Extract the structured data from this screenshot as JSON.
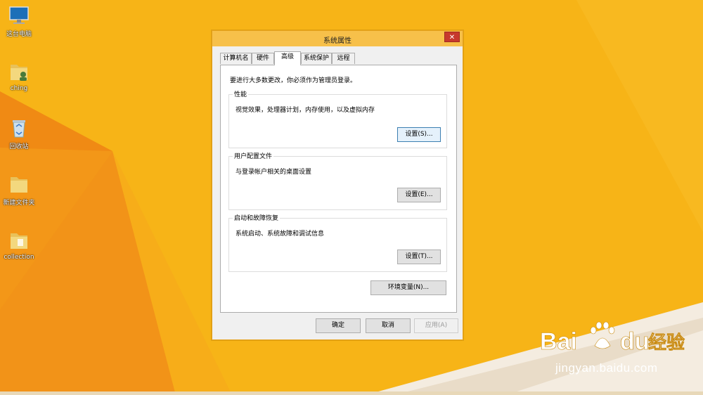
{
  "desktop": {
    "icons": [
      {
        "label": "这台电脑",
        "icon": "this-pc-icon"
      },
      {
        "label": "ching",
        "icon": "user-folder-icon"
      },
      {
        "label": "回收站",
        "icon": "recycle-bin-icon"
      },
      {
        "label": "新建文件夹",
        "icon": "folder-icon"
      },
      {
        "label": "collection",
        "icon": "folder-icon"
      }
    ]
  },
  "dialog": {
    "title": "系统属性",
    "close_symbol": "✕",
    "tabs": [
      {
        "label": "计算机名"
      },
      {
        "label": "硬件"
      },
      {
        "label": "高级"
      },
      {
        "label": "系统保护"
      },
      {
        "label": "远程"
      }
    ],
    "active_tab": "高级",
    "notice": "要进行大多数更改，你必须作为管理员登录。",
    "groups": {
      "performance": {
        "legend": "性能",
        "description": "视觉效果，处理器计划，内存使用，以及虚拟内存",
        "button": "设置(S)..."
      },
      "user_profiles": {
        "legend": "用户配置文件",
        "description": "与登录帐户相关的桌面设置",
        "button": "设置(E)..."
      },
      "startup_recovery": {
        "legend": "启动和故障恢复",
        "description": "系统启动、系统故障和调试信息",
        "button": "设置(T)..."
      }
    },
    "env_button": "环境变量(N)...",
    "footer": {
      "ok": "确定",
      "cancel": "取消",
      "apply": "应用(A)"
    }
  },
  "watermark": {
    "brand": "Bai",
    "brand2": "du",
    "suffix": "经验",
    "url": "jingyan.baidu.com"
  },
  "colors": {
    "wallpaper": "#f7b417",
    "titlebar": "#f7c04a",
    "close": "#c7382d"
  }
}
